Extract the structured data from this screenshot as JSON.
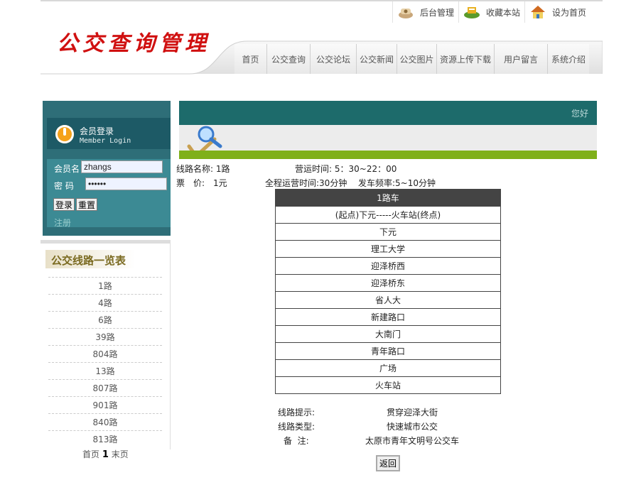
{
  "header": {
    "logo": "公交查询管理",
    "top_links": [
      {
        "label": "后台管理",
        "icon": "phone-icon"
      },
      {
        "label": "收藏本站",
        "icon": "bookmark-icon"
      },
      {
        "label": "设为首页",
        "icon": "home-icon"
      }
    ],
    "nav": [
      "首页",
      "公交查询",
      "公交论坛",
      "公交新闻",
      "公交图片",
      "资源上传下载",
      "用户留言",
      "系统介绍"
    ]
  },
  "login": {
    "title": "会员登录",
    "subtitle": "Member Login",
    "username_label": "会员名",
    "username_value": "zhangs",
    "password_label": "密 码",
    "password_value": "••••••",
    "login_button": "登录",
    "reset_button": "重置",
    "register_link": "注册"
  },
  "routes": {
    "title": "公交线路一览表",
    "items": [
      "1路",
      "4路",
      "6路",
      "39路",
      "804路",
      "13路",
      "807路",
      "901路",
      "840路",
      "813路"
    ],
    "pager": {
      "first": "首页",
      "current": "1",
      "last": "末页"
    }
  },
  "main": {
    "greeting": "您好",
    "line_name": "线路名称: 1路",
    "hours": "营运时间: 5：30~22：00",
    "fare": "票　价:　1元",
    "duration": "全程运营时间:30分钟",
    "frequency": "发车频率:5~10分钟",
    "table_header": "1路车",
    "stops": [
      "(起点)下元-----火车站(终点)",
      "下元",
      "理工大学",
      "迎泽桥西",
      "迎泽桥东",
      "省人大",
      "新建路口",
      "大南门",
      "青年路口",
      "广场",
      "火车站"
    ],
    "tip_label": "线路提示:",
    "tip_value": "贯穿迎泽大街",
    "type_label": "线路类型:",
    "type_value": "快速城市公交",
    "note_label": "备  注:",
    "note_value": "太原市青年文明号公交车",
    "back_button": "返回"
  }
}
